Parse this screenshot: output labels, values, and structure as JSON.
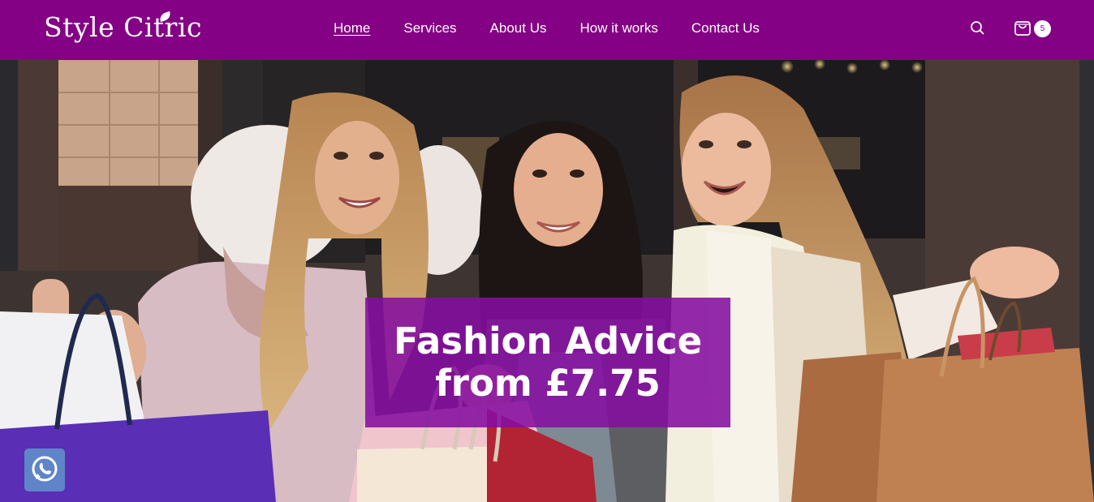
{
  "brand": {
    "logo_text": "Style Citric"
  },
  "nav": {
    "items": [
      {
        "label": "Home",
        "active": true
      },
      {
        "label": "Services"
      },
      {
        "label": "About Us"
      },
      {
        "label": "How it works"
      },
      {
        "label": "Contact Us"
      }
    ],
    "search_icon": "search-icon",
    "cart_icon": "shopping-bag-icon",
    "cart_count": "5"
  },
  "hero": {
    "line1": "Fashion Advice",
    "line2": "from £7.75",
    "image": "three smiling women holding shopping bags"
  },
  "widgets": {
    "chat_icon": "whatsapp-icon"
  },
  "colors": {
    "brand": "#840084",
    "promo_box": "#850ea0",
    "whatsapp": "#5f84c8"
  }
}
